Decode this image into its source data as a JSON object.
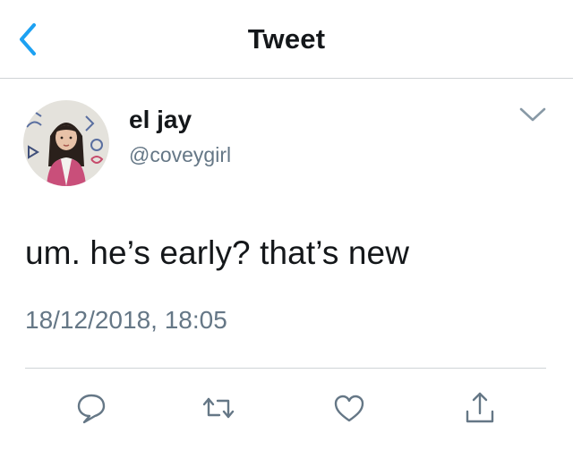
{
  "nav": {
    "title": "Tweet",
    "back_icon": "chevron-left-icon"
  },
  "tweet": {
    "display_name": "el jay",
    "handle": "@coveygirl",
    "text": "um. he’s early? that’s new",
    "timestamp": "18/12/2018, 18:05"
  },
  "actions": [
    {
      "icon": "reply-icon"
    },
    {
      "icon": "retweet-icon"
    },
    {
      "icon": "heart-icon"
    },
    {
      "icon": "share-icon"
    }
  ],
  "colors": {
    "accent": "#1da1f2",
    "secondary_text": "#657786",
    "icon_gray": "#657786",
    "divider": "#cfd3d6"
  }
}
